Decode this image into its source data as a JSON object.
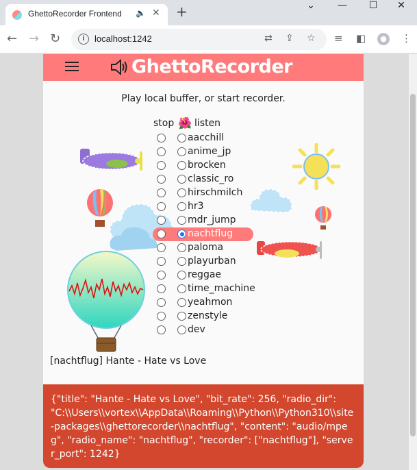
{
  "browser": {
    "tab_title": "GhettoRecorder Frontend",
    "url": "localhost:1242",
    "window_controls": [
      "minimize-icon",
      "maximize-icon",
      "close-icon"
    ]
  },
  "app": {
    "brand": "GhettoRecorder",
    "subtitle": "Play local buffer, or start recorder.",
    "col_stop": "stop",
    "col_listen": "listen",
    "accent_color": "#ff7b7b",
    "footer_color": "#d2472d",
    "stations": [
      {
        "name": "aacchill",
        "listening": false
      },
      {
        "name": "anime_jp",
        "listening": false
      },
      {
        "name": "brocken",
        "listening": false
      },
      {
        "name": "classic_ro",
        "listening": false
      },
      {
        "name": "hirschmilch",
        "listening": false
      },
      {
        "name": "hr3",
        "listening": false
      },
      {
        "name": "mdr_jump",
        "listening": false
      },
      {
        "name": "nachtflug",
        "listening": true
      },
      {
        "name": "paloma",
        "listening": false
      },
      {
        "name": "playurban",
        "listening": false
      },
      {
        "name": "reggae",
        "listening": false
      },
      {
        "name": "time_machine",
        "listening": false
      },
      {
        "name": "yeahmon",
        "listening": false
      },
      {
        "name": "zenstyle",
        "listening": false
      },
      {
        "name": "dev",
        "listening": false
      }
    ],
    "now_playing": "[nachtflug] Hante - Hate vs Love",
    "status_json": "{\"title\": \"Hante - Hate vs Love\", \"bit_rate\": 256, \"radio_dir\": \"C:\\\\Users\\\\vortex\\\\AppData\\\\Roaming\\\\Python\\\\Python310\\\\site-packages\\\\ghettorecorder\\\\nachtflug\", \"content\": \"audio/mpeg\", \"radio_name\": \"nachtflug\", \"recorder\": [\"nachtflug\"], \"server_port\": 1242}"
  }
}
